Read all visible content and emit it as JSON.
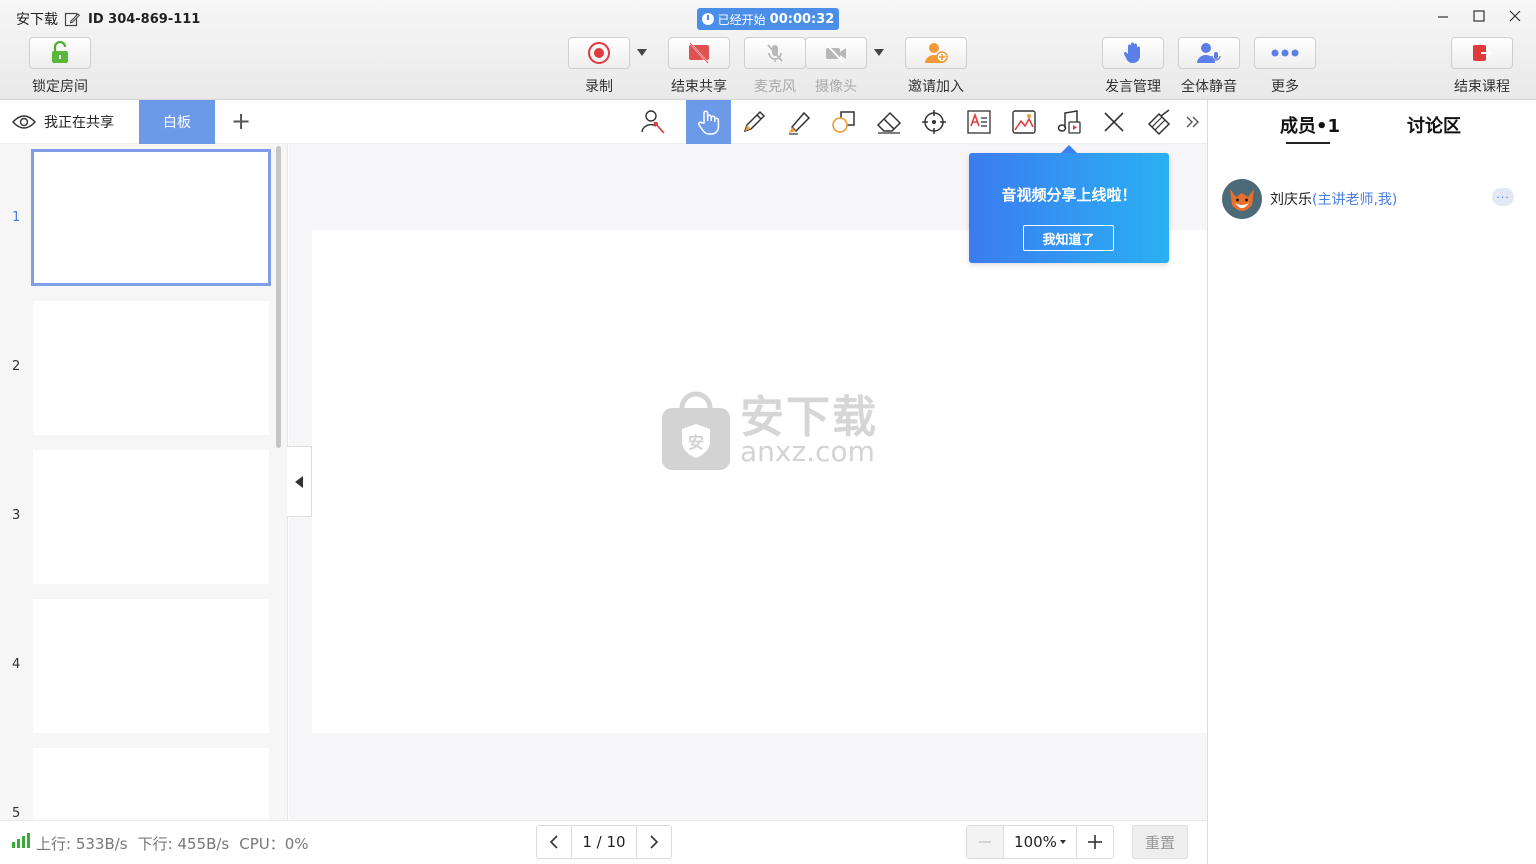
{
  "window": {
    "title": "安下载",
    "meeting_id": "ID 304-869-111",
    "timer_prefix": "已经开始",
    "timer_value": "00:00:32"
  },
  "toolbar": {
    "lock_room": "锁定房间",
    "record": "录制",
    "end_share": "结束共享",
    "microphone": "麦克风",
    "camera": "摄像头",
    "invite": "邀请加入",
    "speech_mgmt": "发言管理",
    "mute_all": "全体静音",
    "more": "更多",
    "end_class": "结束课程"
  },
  "tabs": {
    "sharing_label": "我正在共享",
    "whiteboard": "白板",
    "add": "+"
  },
  "tools": [
    "laser-pointer-icon",
    "hand-icon",
    "pencil-icon",
    "highlighter-icon",
    "shape-icon",
    "eraser-icon",
    "target-icon",
    "text-icon",
    "image-icon",
    "music-icon",
    "close-icon",
    "clear-icon",
    "expand-icon"
  ],
  "thumbnails": [
    "1",
    "2",
    "3",
    "4",
    "5"
  ],
  "popup": {
    "title": "音视频分享上线啦！",
    "button": "我知道了"
  },
  "watermark": {
    "main": "安下载",
    "sub": "anxz.com"
  },
  "right_panel": {
    "tab_members": "成员•1",
    "tab_discussion": "讨论区",
    "member_name": "刘庆乐",
    "member_role": "(主讲老师,我)",
    "member_more": "···"
  },
  "status": {
    "upload": "上行: 533B/s",
    "download": "下行: 455B/s",
    "cpu": "CPU：0%",
    "page": "1 / 10",
    "zoom": "100%",
    "reset": "重置"
  },
  "colors": {
    "accent": "#6d9ae8",
    "timer_bg": "#4a8ee8",
    "popup_start": "#3b7cf0",
    "popup_end": "#2ab0f3",
    "record_red": "#e03a3a",
    "signal_green": "#3aaa3a"
  }
}
